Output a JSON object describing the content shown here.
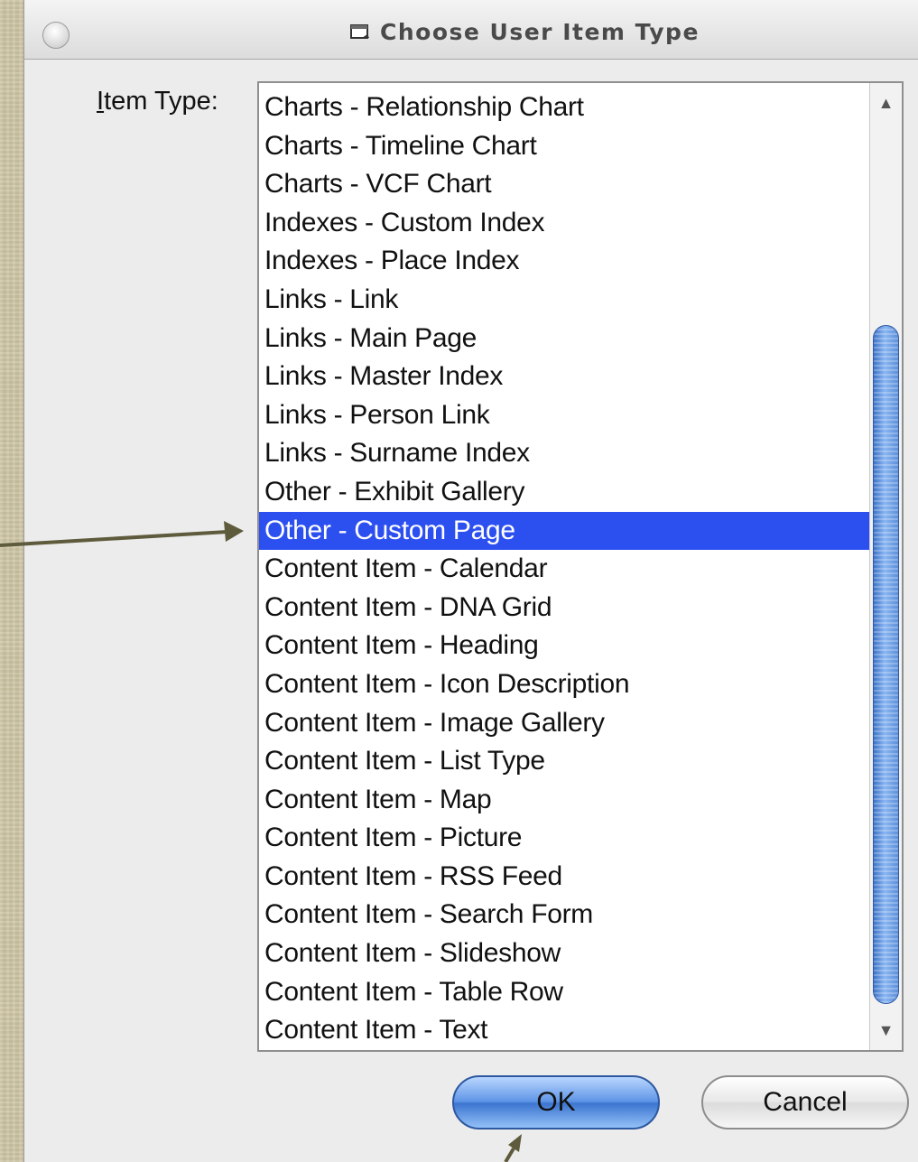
{
  "window": {
    "title": "Choose User Item Type"
  },
  "form": {
    "label_mnemonic": "I",
    "label_rest": "tem Type:"
  },
  "list": {
    "items": [
      "Charts - Relationship Chart",
      "Charts - Timeline Chart",
      "Charts - VCF Chart",
      "Indexes - Custom Index",
      "Indexes - Place Index",
      "Links - Link",
      "Links - Main Page",
      "Links - Master Index",
      "Links - Person Link",
      "Links - Surname Index",
      "Other - Exhibit Gallery",
      "Other - Custom Page",
      "Content Item - Calendar",
      "Content Item - DNA Grid",
      "Content Item - Heading",
      "Content Item - Icon Description",
      "Content Item - Image Gallery",
      "Content Item - List Type",
      "Content Item - Map",
      "Content Item - Picture",
      "Content Item - RSS Feed",
      "Content Item - Search Form",
      "Content Item - Slideshow",
      "Content Item - Table Row",
      "Content Item - Text"
    ],
    "selected_index": 11
  },
  "buttons": {
    "ok_label": "OK",
    "cancel_label": "Cancel"
  },
  "colors": {
    "selection": "#2c4ff0",
    "annotation_arrow": "#5e5a3c"
  },
  "icons": {
    "title": "dialog-window-icon",
    "scroll_up": "up-arrow-icon",
    "scroll_down": "down-arrow-icon"
  }
}
